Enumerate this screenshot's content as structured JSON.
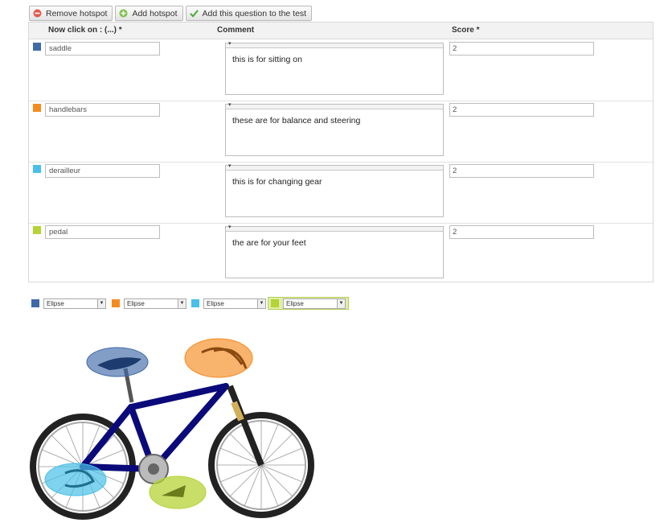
{
  "toolbar": {
    "remove_label": "Remove hotspot",
    "add_label": "Add hotspot",
    "add_question_label": "Add this question to the test"
  },
  "table": {
    "headers": [
      "Now click on : (...) *",
      "Comment",
      "Score *"
    ],
    "rows": [
      {
        "color": "#3f6aa8",
        "answer": "saddle",
        "comment": "this is for sitting on",
        "score": "2"
      },
      {
        "color": "#f58b1f",
        "answer": "handlebars",
        "comment": "these are for balance and steering",
        "score": "2"
      },
      {
        "color": "#48c0e7",
        "answer": "derailleur",
        "comment": "this is for changing gear",
        "score": "2"
      },
      {
        "color": "#b5d335",
        "answer": "pedal",
        "comment": "the are for your feet",
        "score": "2"
      }
    ]
  },
  "shapes": [
    {
      "color": "#3f6aa8",
      "value": "Elipse"
    },
    {
      "color": "#f58b1f",
      "value": "Elipse"
    },
    {
      "color": "#48c0e7",
      "value": "Elipse"
    },
    {
      "color": "#b5d335",
      "value": "Elipse",
      "active": true
    }
  ],
  "icons": {
    "remove": "minus-circle-icon",
    "add": "plus-circle-icon",
    "add_question": "checkmark-icon",
    "dropdown": "dropdown-arrow-icon",
    "image": "bicycle-image"
  }
}
